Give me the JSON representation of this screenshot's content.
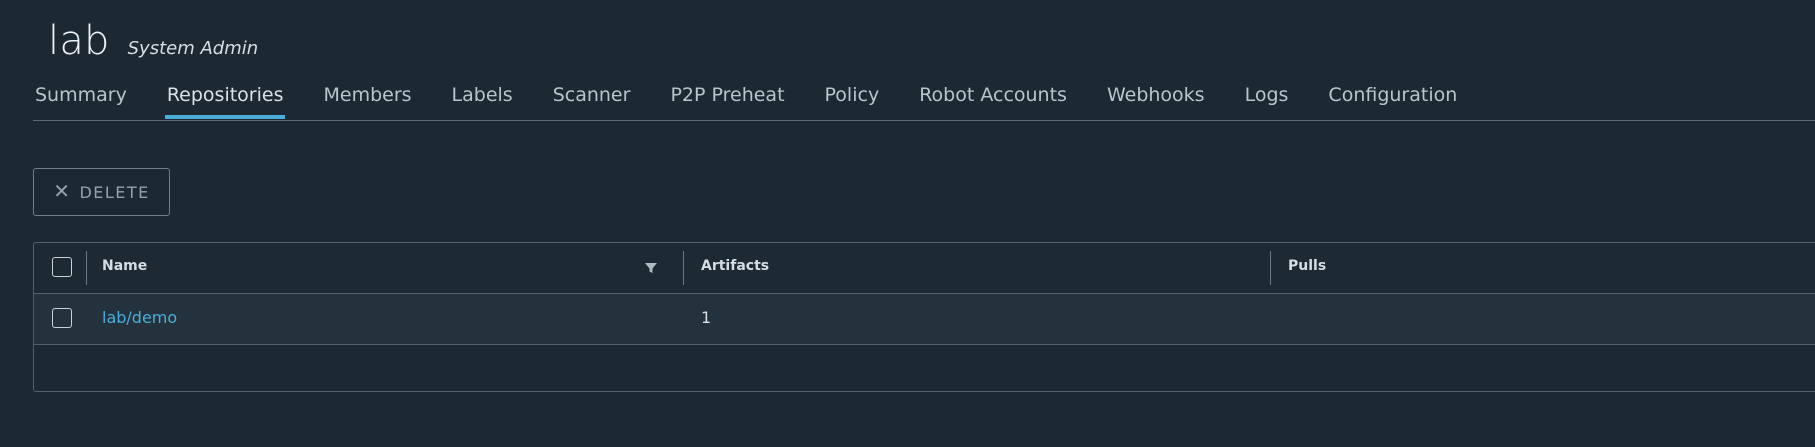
{
  "header": {
    "project_name": "lab",
    "role": "System Admin"
  },
  "tabs": [
    {
      "label": "Summary",
      "active": false
    },
    {
      "label": "Repositories",
      "active": true
    },
    {
      "label": "Members",
      "active": false
    },
    {
      "label": "Labels",
      "active": false
    },
    {
      "label": "Scanner",
      "active": false
    },
    {
      "label": "P2P Preheat",
      "active": false
    },
    {
      "label": "Policy",
      "active": false
    },
    {
      "label": "Robot Accounts",
      "active": false
    },
    {
      "label": "Webhooks",
      "active": false
    },
    {
      "label": "Logs",
      "active": false
    },
    {
      "label": "Configuration",
      "active": false
    }
  ],
  "toolbar": {
    "delete_label": "DELETE",
    "delete_icon": "close-icon"
  },
  "table": {
    "columns": [
      "Name",
      "Artifacts",
      "Pulls"
    ],
    "rows": [
      {
        "name": "lab/demo",
        "artifacts": "1",
        "pulls": ""
      }
    ]
  },
  "colors": {
    "background": "#1c2832",
    "accent": "#49aeda",
    "row_background": "#23323c"
  }
}
